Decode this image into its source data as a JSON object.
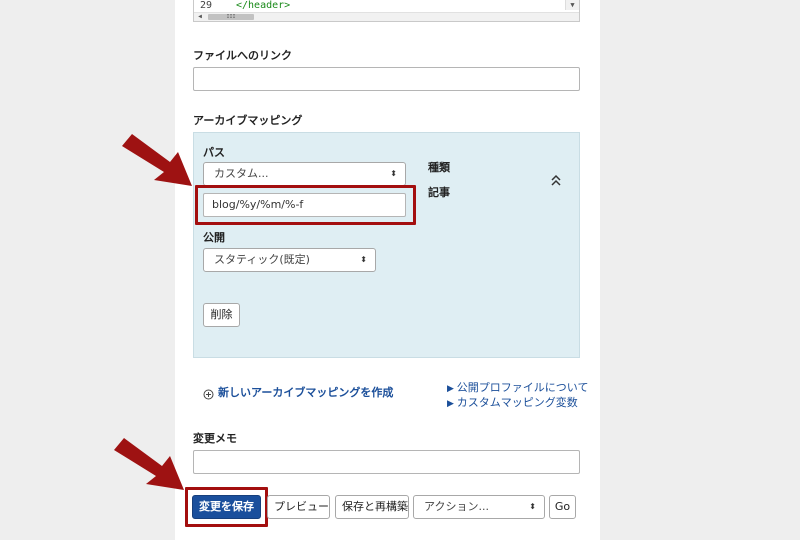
{
  "code_editor": {
    "line_number": "29",
    "line_code": "</header>",
    "scroll_thumb": "III"
  },
  "file_link": {
    "label": "ファイルへのリンク",
    "value": ""
  },
  "archive_mapping": {
    "heading": "アーカイブマッピング",
    "path_label": "パス",
    "path_select_value": "カスタム...",
    "path_input_value": "blog/%y/%m/%-f",
    "type_label": "種類",
    "type_value": "記事",
    "publish_label": "公開",
    "publish_select_value": "スタティック(既定)",
    "delete_button": "削除",
    "collapse_icon": "double-chevron-up-icon",
    "create_link": "新しいアーカイブマッピングを作成",
    "create_icon": "plus-circle-icon"
  },
  "help_links": [
    "公開プロファイルについて",
    "カスタムマッピング変数"
  ],
  "change_note": {
    "label": "変更メモ",
    "value": ""
  },
  "actions": {
    "save": "変更を保存",
    "preview": "プレビュー",
    "save_rebuild": "保存と再構築",
    "action_select": "アクション...",
    "go": "Go"
  },
  "colors": {
    "primary": "#1a4f9c",
    "highlight": "#a30f0f",
    "panel": "#dfeef3",
    "link": "#1b4f9a"
  }
}
